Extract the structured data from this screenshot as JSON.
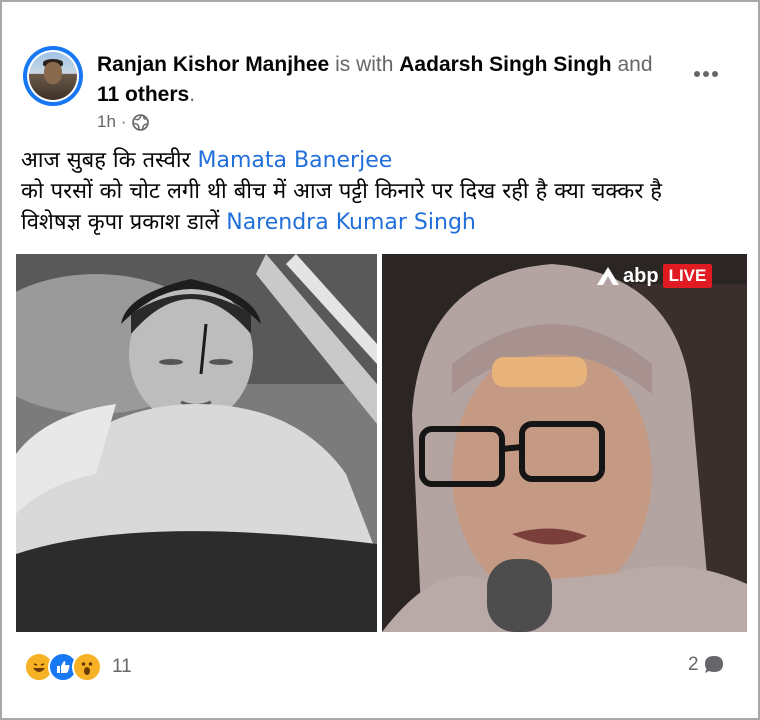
{
  "post": {
    "author": "Ranjan Kishor Manjhee",
    "with_text": "is with",
    "tagged": "Aadarsh Singh Singh",
    "and_text": "and",
    "others": "11 others",
    "period": ".",
    "time": "1h",
    "separator": "·",
    "text": {
      "line1": "आज सुबह कि तस्वीर",
      "mention1": "Mamata Banerjee",
      "line2": "को परसों को चोट लगी थी बीच में आज पट्टी किनारे पर दिख रही है क्या चक्कर है",
      "line3": "विशेषज्ञ कृपा प्रकाश डालें",
      "mention2": "Narendra Kumar Singh"
    },
    "images": {
      "right_badge": "abp",
      "right_live": "LIVE"
    },
    "reactions": {
      "icons": [
        "haha-icon",
        "like-icon",
        "wow-icon"
      ],
      "count": "11"
    },
    "comments": {
      "count": "2",
      "icon": "comment-icon"
    }
  },
  "colors": {
    "mention": "#216fdb",
    "secondary_text": "#65676b",
    "like_blue": "#1877f2",
    "reaction_yellow": "#f7b125",
    "live_red": "#e11b22"
  }
}
